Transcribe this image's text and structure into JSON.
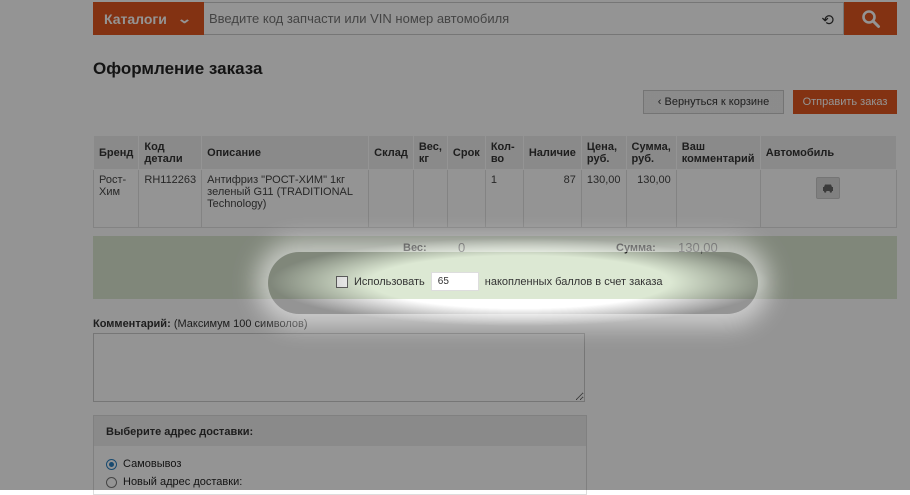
{
  "search": {
    "catalog_label": "Каталоги",
    "placeholder": "Введите код запчасти или VIN номер автомобиля"
  },
  "page_title": "Оформление заказа",
  "buttons": {
    "back": "‹ Вернуться к корзине",
    "send": "Отправить заказ"
  },
  "table": {
    "headers": [
      "Бренд",
      "Код детали",
      "Описание",
      "Склад",
      "Вес, кг",
      "Срок",
      "Кол-во",
      "Наличие",
      "Цена, руб.",
      "Сумма, руб.",
      "Ваш комментарий",
      "Автомобиль"
    ],
    "rows": [
      {
        "brand": "Рост-Хим",
        "code": "RH112263",
        "description": "Антифриз \"РОСТ-ХИМ\" 1кг зеленый G11 (TRADITIONAL Technology)",
        "warehouse": "",
        "weight": "",
        "term": "",
        "qty": "1",
        "stock": "87",
        "price": "130,00",
        "sum": "130,00",
        "comment": ""
      }
    ]
  },
  "summary": {
    "weight_label": "Вес:",
    "weight_value": "0",
    "sum_label": "Сумма:",
    "sum_value": "130,00",
    "use_label": "Использовать",
    "points_value": "65",
    "points_suffix": "накопленных баллов в счет заказа"
  },
  "comment": {
    "label": "Комментарий:",
    "hint": "(Максимум 100 символов)"
  },
  "delivery": {
    "title": "Выберите адрес доставки:",
    "options": [
      "Самовывоз",
      "Новый адрес доставки:"
    ],
    "selected": "Самовывоз"
  },
  "colors": {
    "accent": "#e2571f",
    "summary_bg": "#dce8d3"
  }
}
